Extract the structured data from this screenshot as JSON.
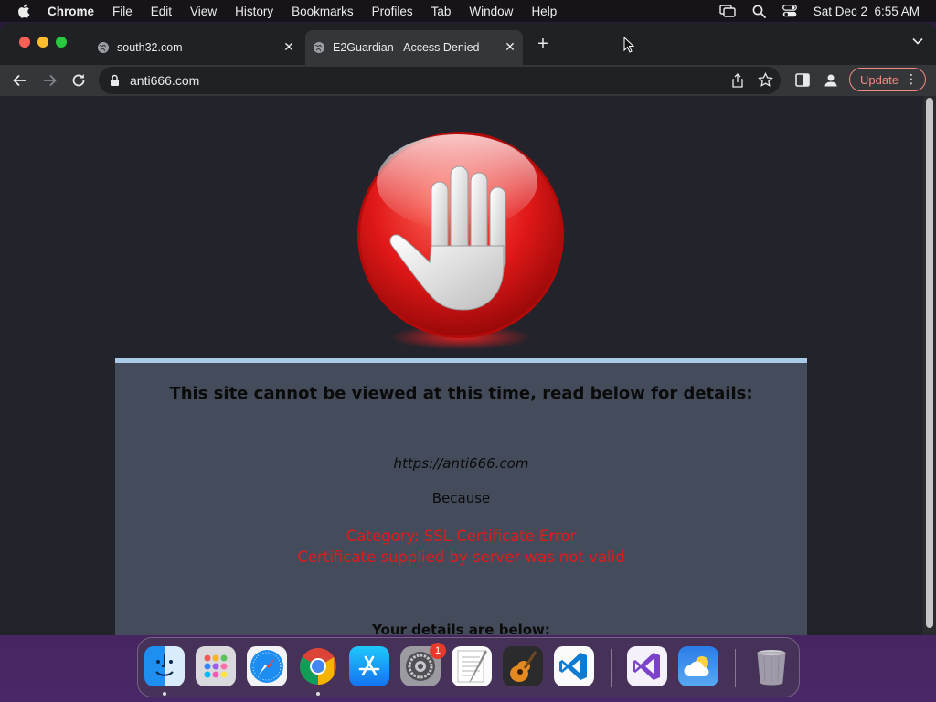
{
  "menubar": {
    "app": "Chrome",
    "items": [
      "File",
      "Edit",
      "View",
      "History",
      "Bookmarks",
      "Profiles",
      "Tab",
      "Window",
      "Help"
    ],
    "clock": "Sat Dec 2  6:55 AM"
  },
  "tabs": [
    {
      "title": "south32.com",
      "active": false
    },
    {
      "title": "E2Guardian - Access Denied",
      "active": true
    }
  ],
  "toolbar": {
    "url": "anti666.com",
    "update_label": "Update"
  },
  "page": {
    "heading": "This site cannot be viewed at this time, read below for details:",
    "blocked_url": "https://anti666.com",
    "because_label": "Because",
    "reason_line1": "Category: SSL Certificate Error",
    "reason_line2": "Certificate supplied by server was not valid",
    "details_label": "Your details are below:"
  },
  "dock": {
    "apps": [
      "Finder",
      "Launchpad",
      "Safari",
      "Chrome",
      "App Store",
      "System Settings",
      "TextEdit",
      "GarageBand",
      "Visual Studio Code",
      "Visual Studio",
      "Weather",
      "Trash"
    ],
    "settings_badge": "1"
  },
  "colors": {
    "accent_update": "#f28b82",
    "error_text": "#e01b1b",
    "card_bg": "#444b5a",
    "card_border": "#a9cbe8"
  }
}
